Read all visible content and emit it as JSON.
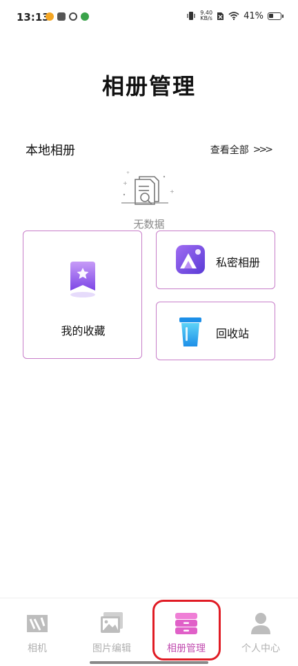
{
  "status_bar": {
    "time": "13:13",
    "net_speed_value": "9.40",
    "net_speed_unit": "KB/s",
    "battery": "41%",
    "battery_level": 0.41
  },
  "page": {
    "title": "相册管理"
  },
  "local_album": {
    "title": "本地相册",
    "view_all": "查看全部",
    "view_all_arrows": ">>>",
    "empty_text": "无数据"
  },
  "cards": {
    "favorites": "我的收藏",
    "private_album": "私密相册",
    "recycle_bin": "回收站"
  },
  "tabs": [
    {
      "label": "相机",
      "icon": "camera-icon",
      "active": false
    },
    {
      "label": "图片编辑",
      "icon": "image-edit-icon",
      "active": false
    },
    {
      "label": "相册管理",
      "icon": "album-manage-icon",
      "active": true
    },
    {
      "label": "个人中心",
      "icon": "person-icon",
      "active": false
    }
  ],
  "colors": {
    "accent": "#c24db0",
    "card_border": "#c77cc8",
    "highlight_red": "#e01b24",
    "tab_inactive": "#b0b0b0"
  }
}
